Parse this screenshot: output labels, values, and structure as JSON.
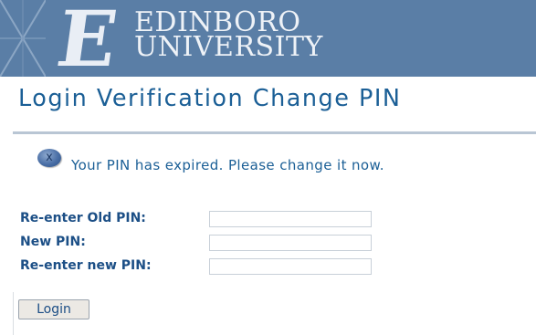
{
  "header": {
    "logo_letter": "E",
    "university_line1": "EDINBORO",
    "university_line2": "UNIVERSITY"
  },
  "page_title": "Login Verification Change PIN",
  "message": {
    "icon": "info-icon",
    "text": "Your PIN has expired. Please change it now."
  },
  "form": {
    "old_pin_label": "Re-enter Old PIN:",
    "old_pin_value": "",
    "new_pin_label": "New PIN:",
    "new_pin_value": "",
    "confirm_pin_label": "Re-enter new PIN:",
    "confirm_pin_value": "",
    "submit_label": "Login"
  },
  "colors": {
    "banner": "#5a7ea6",
    "title": "#1b5f96",
    "label": "#1c4f86"
  }
}
